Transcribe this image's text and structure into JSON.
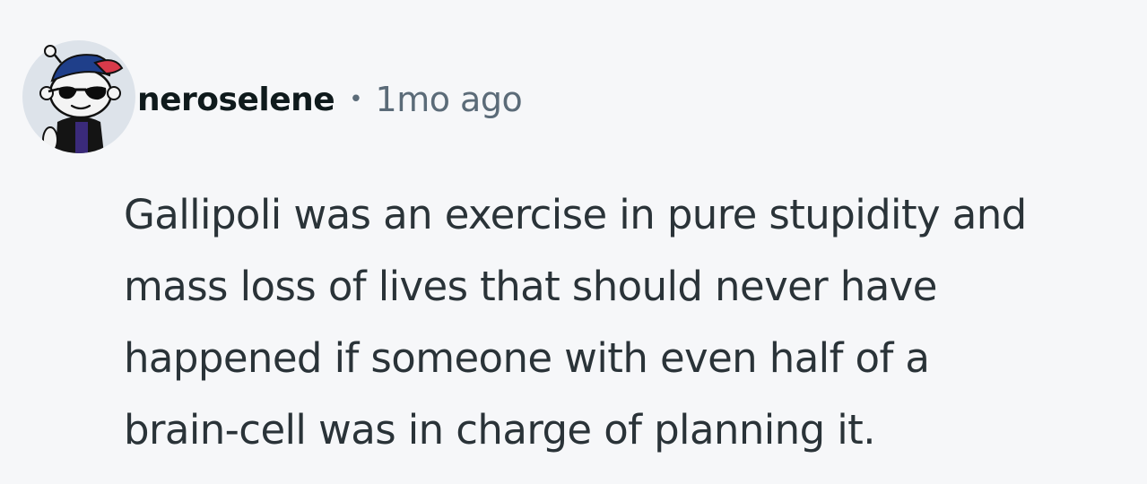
{
  "comment": {
    "author": {
      "username": "neroselene",
      "avatar_icon": "snoo-avatar-icon"
    },
    "separator": "•",
    "timestamp": "1mo ago",
    "body_lines": [
      "Gallipoli was an exercise in pure stupidity and",
      "mass loss of lives that should never have",
      "happened if someone with even half of a",
      "brain-cell was in charge of planning it."
    ]
  },
  "colors": {
    "background": "#f6f7f9",
    "username": "#0f1a1c",
    "meta": "#5b6b78",
    "body_text": "#2a3338"
  }
}
